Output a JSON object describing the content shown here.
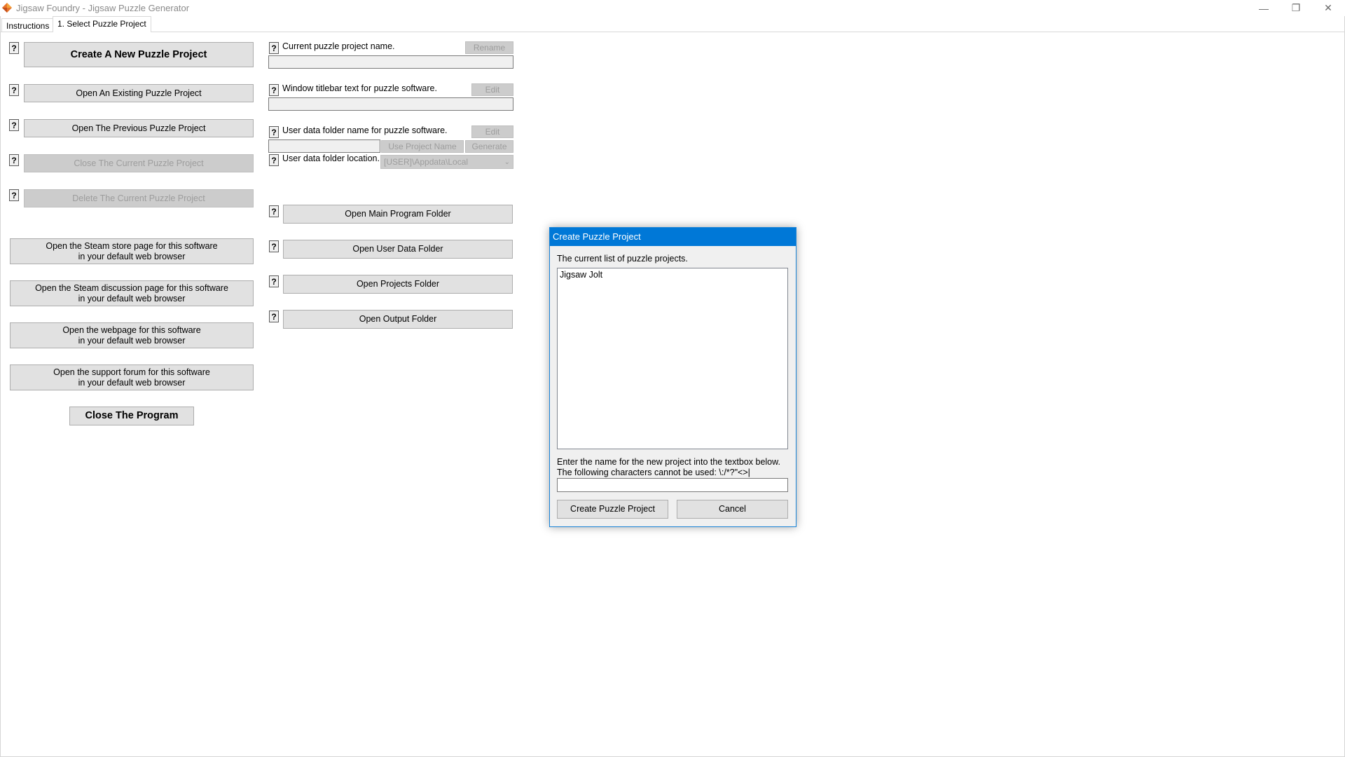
{
  "window": {
    "title": "Jigsaw Foundry - Jigsaw Puzzle Generator",
    "controls": {
      "minimize": "—",
      "restore": "❐",
      "close": "✕"
    }
  },
  "tabs": [
    {
      "label": "Instructions",
      "active": false
    },
    {
      "label": "1. Select Puzzle Project",
      "active": true
    }
  ],
  "help_glyph": "?",
  "left_buttons": {
    "create": "Create A New Puzzle Project",
    "open_existing": "Open An Existing Puzzle Project",
    "open_previous": "Open The Previous Puzzle Project",
    "close_current": "Close The Current Puzzle Project",
    "delete_current": "Delete The Current Puzzle Project",
    "steam_store": "Open the Steam store page for this software\nin your default web browser",
    "steam_discussion": "Open the Steam discussion page for this software\nin your default web browser",
    "webpage": "Open the webpage for this software\nin your default web browser",
    "support_forum": "Open the support forum for this software\nin your default web browser",
    "close_program": "Close The Program"
  },
  "project_settings": {
    "name_label": "Current puzzle project name.",
    "rename_button": "Rename",
    "titlebar_label": "Window titlebar text for puzzle software.",
    "titlebar_edit_button": "Edit",
    "userdata_label": "User data folder name for puzzle software.",
    "userdata_edit_button": "Edit",
    "use_project_name_button": "Use Project Name",
    "generate_button": "Generate",
    "location_label": "User data folder location.",
    "location_value": "[USER]\\Appdata\\Local"
  },
  "folder_buttons": {
    "main_program": "Open Main Program Folder",
    "user_data": "Open User Data Folder",
    "projects": "Open Projects Folder",
    "output": "Open Output Folder"
  },
  "dialog": {
    "title": "Create Puzzle Project",
    "list_label": "The current list of puzzle projects.",
    "projects": [
      "Jigsaw Jolt"
    ],
    "instruction_line1": "Enter the name for the new project into the textbox below.",
    "instruction_line2": "The following characters cannot be used: \\:/*?\"<>|",
    "name_value": "",
    "create_button": "Create Puzzle Project",
    "cancel_button": "Cancel"
  },
  "colors": {
    "accent": "#0078d7",
    "button_face": "#e1e1e1",
    "disabled_face": "#cccccc",
    "disabled_text": "#9d9d9d"
  }
}
